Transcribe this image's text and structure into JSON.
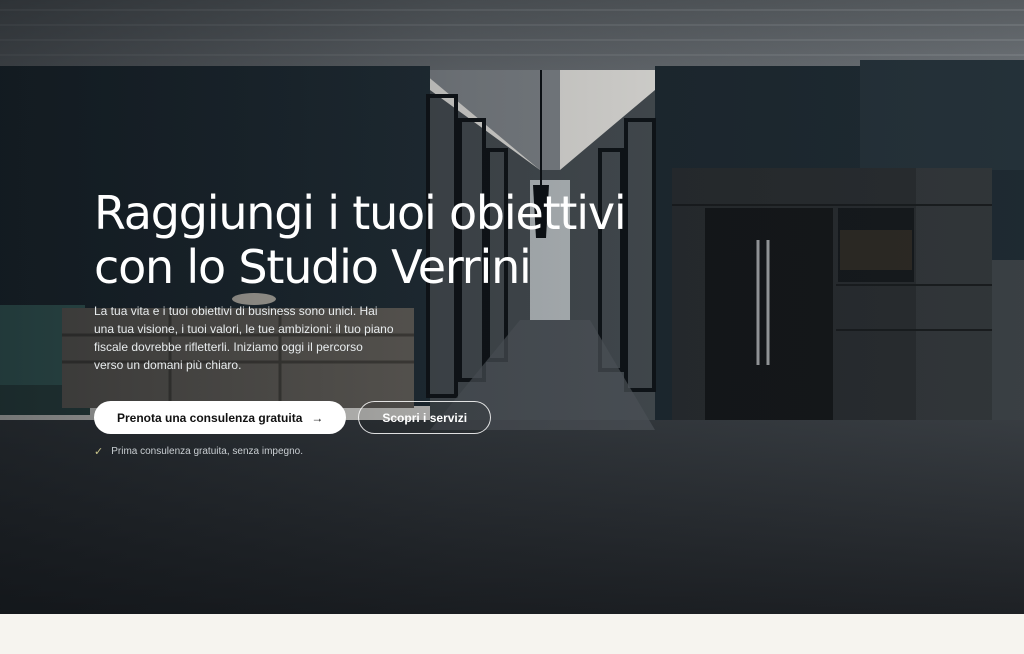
{
  "hero": {
    "title_line1": "Raggiungi i tuoi obiettivi",
    "title_line2": "con lo Studio Verrini",
    "lead": "La tua vita e i tuoi obiettivi di business sono unici. Hai una tua visione, i tuoi valori, le tue ambizioni: il tuo piano fiscale dovrebbe rifletterli. Iniziamo oggi il percorso verso un domani più chiaro.",
    "cta_primary": "Prenota una consulenza gratuita",
    "cta_primary_icon": "arrow-right-icon",
    "cta_secondary": "Scopri i servizi",
    "note": "Prima consulenza gratuita, senza impegno.",
    "note_icon": "check-icon"
  },
  "colors": {
    "primary_button_bg": "#ffffff",
    "text_on_hero": "#ffffff",
    "page_bg": "#f6f4ef",
    "check_accent": "#c7c38a"
  }
}
